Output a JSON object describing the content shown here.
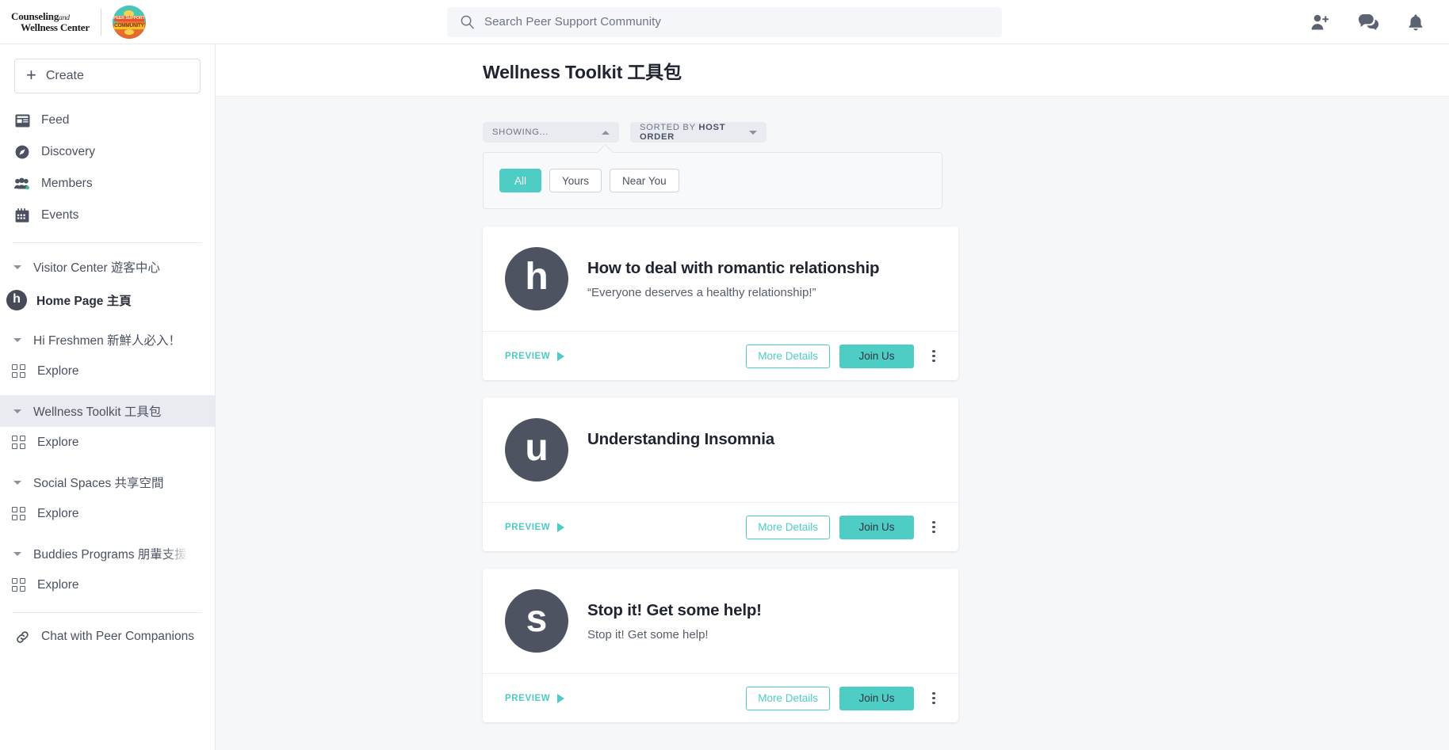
{
  "topbar": {
    "brand": {
      "line1": "Counseling",
      "line1_italic": "and",
      "line2": "Wellness Center",
      "badge_line1": "PEER SUPPORT",
      "badge_line2": "COMMUNITY"
    },
    "search": {
      "placeholder": "Search Peer Support Community"
    },
    "actions": [
      {
        "name": "add-person-icon"
      },
      {
        "name": "messages-icon"
      },
      {
        "name": "notifications-bell-icon"
      }
    ]
  },
  "sidebar": {
    "create_label": "Create",
    "nav": [
      {
        "label": "Feed",
        "icon": "feed-icon"
      },
      {
        "label": "Discovery",
        "icon": "compass-icon"
      },
      {
        "label": "Members",
        "icon": "members-icon"
      },
      {
        "label": "Events",
        "icon": "calendar-icon"
      }
    ],
    "groups": [
      {
        "label": "Visitor Center 遊客中心",
        "active": false,
        "truncated": false
      },
      {
        "label": "Hi Freshmen 新鮮人必入！",
        "active": false,
        "truncated": false
      },
      {
        "label": "Wellness Toolkit 工具包",
        "active": true,
        "truncated": false
      },
      {
        "label": "Social Spaces 共享空間",
        "active": false,
        "truncated": false
      },
      {
        "label": "Buddies Programs 朋輩支援計劃",
        "active": false,
        "truncated": true
      }
    ],
    "home_page": {
      "avatar_letter": "h",
      "label": "Home Page 主頁"
    },
    "explore_label": "Explore",
    "chat_link_label": "Chat with Peer Companions"
  },
  "main": {
    "page_title": "Wellness Toolkit 工具包",
    "filters": {
      "showing_label": "SHOWING...",
      "sorted_prefix": "SORTED BY ",
      "sorted_value": "HOST ORDER",
      "chips": [
        {
          "label": "All",
          "selected": true
        },
        {
          "label": "Yours",
          "selected": false
        },
        {
          "label": "Near You",
          "selected": false
        }
      ]
    },
    "card_actions": {
      "preview_label": "PREVIEW",
      "more_details_label": "More Details",
      "join_label": "Join Us"
    },
    "cards": [
      {
        "avatar_letter": "h",
        "title": "How to deal with romantic relationship",
        "subtitle": "“Everyone deserves a healthy relationship!”"
      },
      {
        "avatar_letter": "u",
        "title": "Understanding Insomnia",
        "subtitle": ""
      },
      {
        "avatar_letter": "s",
        "title": "Stop it! Get some help!",
        "subtitle": "Stop it! Get some help!"
      }
    ]
  },
  "colors": {
    "accent_teal": "#4ECDC4",
    "avatar_gray": "#4d5360",
    "content_bg": "#f6f7f9",
    "text_dark": "#1f2430"
  }
}
